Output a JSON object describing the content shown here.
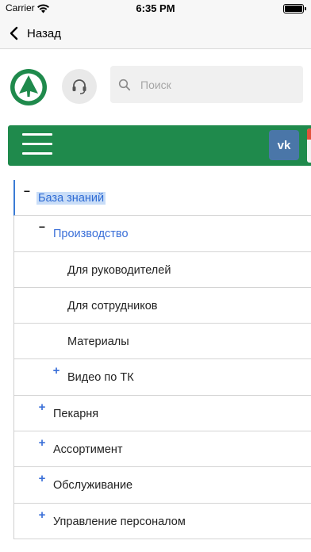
{
  "status_bar": {
    "carrier": "Carrier",
    "time": "6:35 PM"
  },
  "nav": {
    "back_label": "Назад"
  },
  "header": {
    "search_placeholder": "Поиск"
  },
  "menu": {
    "vk_label": "vk"
  },
  "colors": {
    "brand_green": "#1f8a4c",
    "link_blue": "#3a6fd8",
    "vk_blue": "#4a76a8"
  },
  "tree": [
    {
      "label": "База знаний",
      "level": 0,
      "toggle": "minus",
      "state": "selected"
    },
    {
      "label": "Производство",
      "level": 1,
      "toggle": "minus",
      "state": "link"
    },
    {
      "label": "Для руководителей",
      "level": 2,
      "toggle": "none",
      "state": "normal"
    },
    {
      "label": "Для сотрудников",
      "level": 2,
      "toggle": "none",
      "state": "normal"
    },
    {
      "label": "Материалы",
      "level": 2,
      "toggle": "none",
      "state": "normal"
    },
    {
      "label": "Видео по ТК",
      "level": 2,
      "toggle": "plus",
      "state": "normal"
    },
    {
      "label": "Пекарня",
      "level": 1,
      "toggle": "plus",
      "state": "normal"
    },
    {
      "label": "Ассортимент",
      "level": 1,
      "toggle": "plus",
      "state": "normal"
    },
    {
      "label": "Обслуживание",
      "level": 1,
      "toggle": "plus",
      "state": "normal"
    },
    {
      "label": "Управление персоналом",
      "level": 1,
      "toggle": "plus",
      "state": "normal"
    }
  ]
}
